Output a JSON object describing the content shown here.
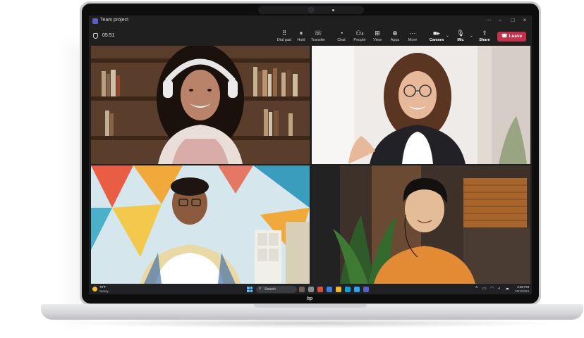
{
  "window": {
    "title": "Team project"
  },
  "meeting": {
    "timer": "05:51",
    "toolbar": [
      {
        "label": "Dial pad",
        "icon": "dialpad-icon",
        "glyph": "⠿"
      },
      {
        "label": "Hold",
        "icon": "pause-icon",
        "glyph": "⏸"
      },
      {
        "label": "Transfer",
        "icon": "transfer-icon",
        "glyph": "☏"
      },
      {
        "label": "Chat",
        "icon": "chat-icon",
        "glyph": "💬"
      },
      {
        "label": "People",
        "icon": "people-icon",
        "glyph": "👥",
        "badge": "4"
      },
      {
        "label": "View",
        "icon": "view-grid-icon",
        "glyph": "⊞"
      },
      {
        "label": "Apps",
        "icon": "apps-icon",
        "glyph": "⊕"
      },
      {
        "label": "More",
        "icon": "more-icon",
        "glyph": "⋯"
      },
      {
        "label": "Camera",
        "icon": "camera-icon",
        "glyph": "▶"
      },
      {
        "label": "Mic",
        "icon": "mic-icon",
        "glyph": "🎙"
      },
      {
        "label": "Share",
        "icon": "share-icon",
        "glyph": "⇧"
      }
    ],
    "leave_label": "Leave",
    "accent_leave": "#c4314b"
  },
  "participants": [
    {
      "tile": "top-left",
      "description_icon": "participant-video"
    },
    {
      "tile": "top-right",
      "description_icon": "participant-video"
    },
    {
      "tile": "bottom-left",
      "description_icon": "participant-video"
    },
    {
      "tile": "bottom-right",
      "description_icon": "participant-video"
    }
  ],
  "taskbar": {
    "weather_temp": "79°F",
    "weather_condition": "Sunny",
    "search_placeholder": "Search",
    "time": "2:30 PM",
    "date": "10/1/2024"
  },
  "brand": {
    "logo_text": "hp"
  }
}
